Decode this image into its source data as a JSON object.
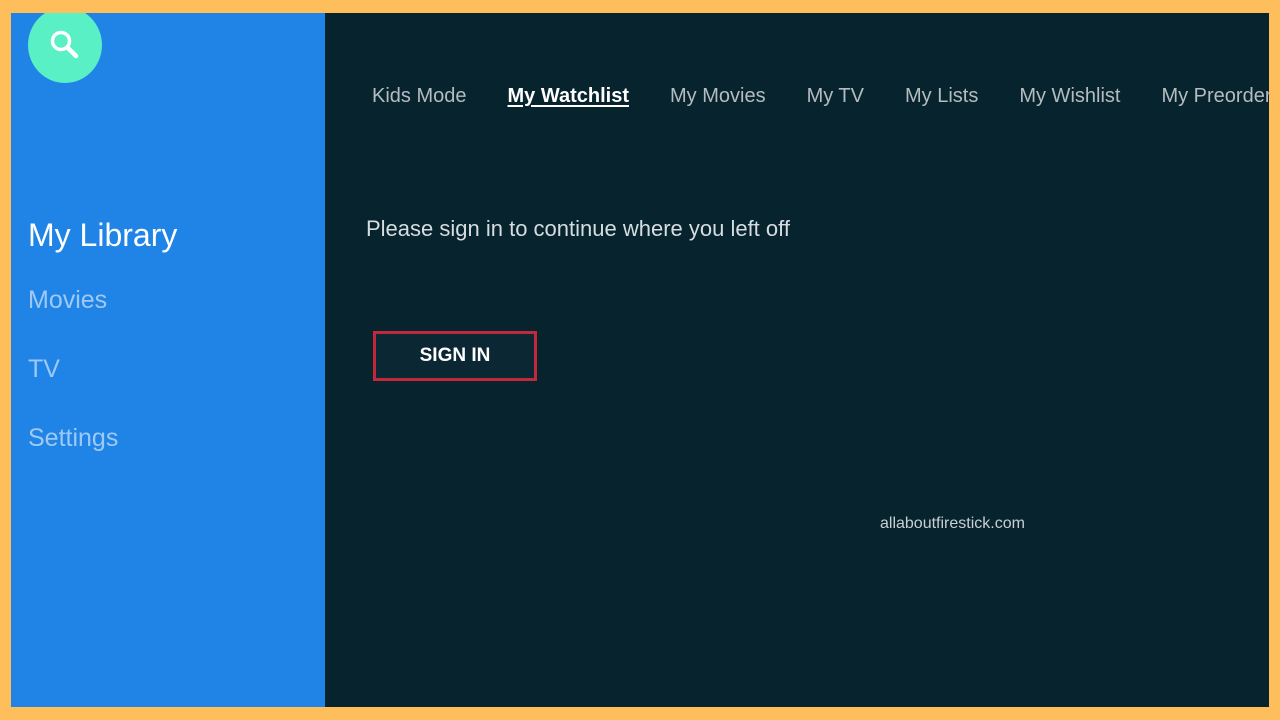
{
  "sidebar": {
    "search_icon": "search-icon",
    "items": [
      {
        "label": "My Library",
        "active": true
      },
      {
        "label": "Movies"
      },
      {
        "label": "TV"
      },
      {
        "label": "Settings"
      }
    ]
  },
  "tabs": [
    {
      "label": "Kids Mode"
    },
    {
      "label": "My Watchlist",
      "active": true
    },
    {
      "label": "My Movies"
    },
    {
      "label": "My TV"
    },
    {
      "label": "My Lists"
    },
    {
      "label": "My Wishlist"
    },
    {
      "label": "My Preorder"
    }
  ],
  "main": {
    "message": "Please sign in to continue where you left off",
    "sign_in_label": "SIGN IN"
  },
  "watermark": "allaboutfirestick.com",
  "colors": {
    "page_border": "#ffbe5c",
    "sidebar_bg": "#1f84e6",
    "main_bg": "#06232e",
    "search_button": "#59f0c6",
    "highlight_border": "#c3283a"
  }
}
